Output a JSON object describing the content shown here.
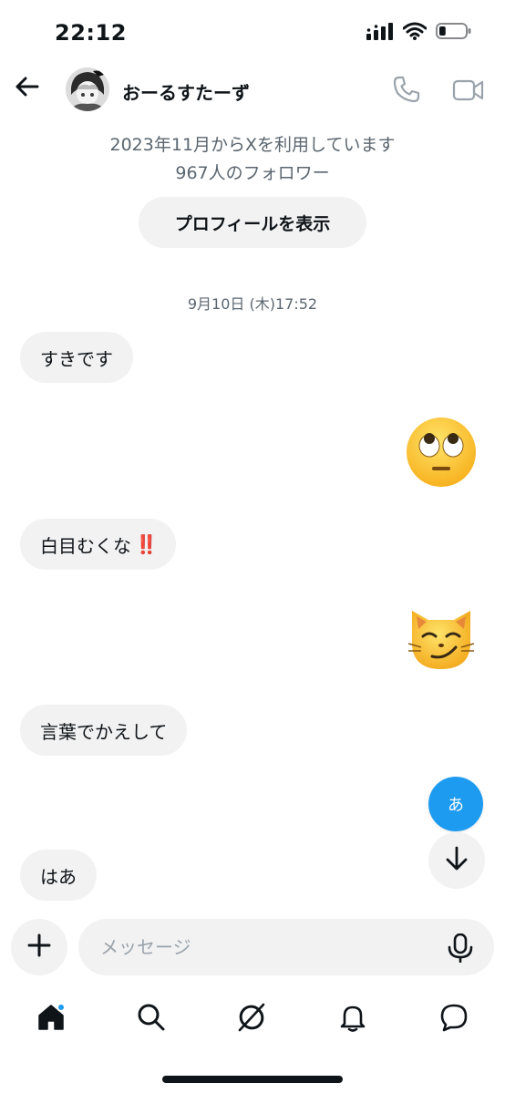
{
  "status_bar": {
    "time": "22:12",
    "icons": [
      "signal-icon",
      "wifi-icon",
      "battery-icon"
    ],
    "battery_level": 0.25
  },
  "header": {
    "back_icon": "arrow-left-icon",
    "contact_name": "おーるすたーず",
    "call_icon": "phone-icon",
    "video_icon": "video-camera-icon"
  },
  "profile_info": {
    "joined": "2023年11月からXを利用しています",
    "followers": "967人のフォロワー",
    "view_profile_label": "プロフィールを表示"
  },
  "conversation": {
    "date_label": "9月10日 (木)17:52",
    "messages": [
      {
        "side": "received",
        "text": "すきです"
      },
      {
        "side": "sent",
        "emoji": "face-with-rolling-eyes"
      },
      {
        "side": "received",
        "text": "白目むくな",
        "suffix": "‼️"
      },
      {
        "side": "sent",
        "emoji": "cat-with-wry-smile"
      },
      {
        "side": "received",
        "text": "言葉でかえして"
      },
      {
        "side": "received",
        "text": "はあ"
      }
    ]
  },
  "floating": {
    "translate_label": "あ",
    "scroll_down_icon": "arrow-down-icon"
  },
  "composer": {
    "add_icon": "plus-icon",
    "placeholder": "メッセージ",
    "mic_icon": "microphone-icon"
  },
  "tab_bar": {
    "tabs": [
      {
        "name": "home",
        "icon": "home-icon",
        "active": true,
        "badge": true
      },
      {
        "name": "search",
        "icon": "search-icon"
      },
      {
        "name": "grok",
        "icon": "grok-icon"
      },
      {
        "name": "notifications",
        "icon": "bell-icon"
      },
      {
        "name": "messages",
        "icon": "chat-bubble-icon"
      }
    ]
  },
  "colors": {
    "accent": "#1d9bf0",
    "text": "#0f1419",
    "secondary_text": "#5b6670",
    "bubble_bg": "#f2f2f2",
    "exclaim_red": "#e0191f"
  }
}
